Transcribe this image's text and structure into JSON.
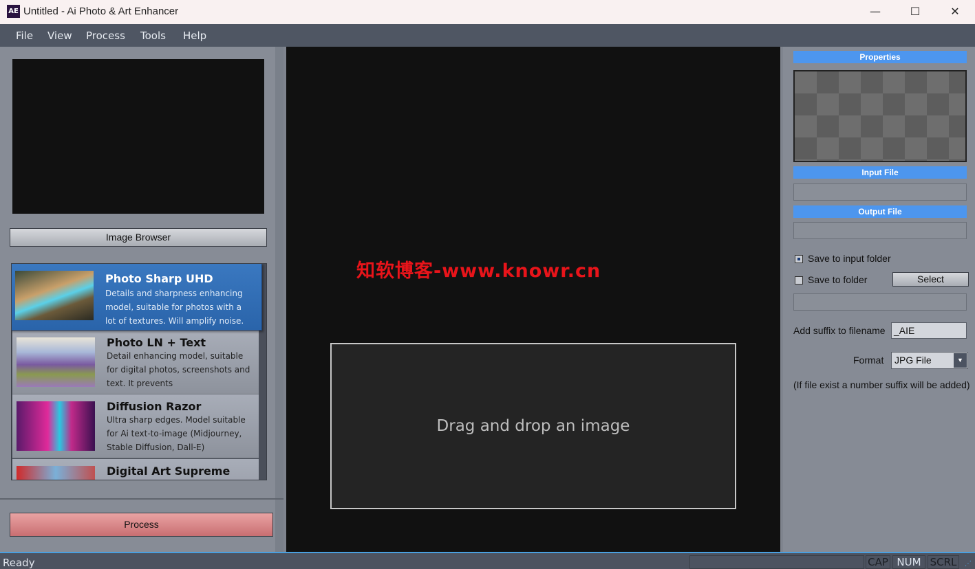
{
  "window": {
    "title": "Untitled - Ai Photo & Art Enhancer",
    "app_icon": "AE",
    "minimize": "—",
    "maximize": "☐",
    "close": "✕"
  },
  "menu": [
    "File",
    "View",
    "Process",
    "Tools",
    "Help"
  ],
  "left": {
    "image_browser": "Image Browser",
    "process": "Process",
    "models": [
      {
        "name": "Photo Sharp UHD",
        "desc": "Details and sharpness enhancing model, suitable for photos with a lot of textures. Will amplify noise.",
        "selected": true
      },
      {
        "name": "Photo LN + Text",
        "desc": "Detail enhancing model, suitable for digital photos, screenshots and text. It prevents"
      },
      {
        "name": "Diffusion Razor",
        "desc": "Ultra sharp edges. Model suitable for Ai text-to-image (Midjourney, Stable Diffusion, Dall-E)"
      },
      {
        "name": "Digital Art Supreme",
        "desc": ""
      }
    ]
  },
  "center": {
    "drop_text": "Drag and drop an image",
    "watermark": "知软博客-www.knowr.cn"
  },
  "right": {
    "properties": "Properties",
    "input_file": "Input File",
    "output_file": "Output File",
    "input_value": "",
    "output_value": "",
    "save_input": "Save to input folder",
    "save_input_checked": true,
    "save_folder": "Save to folder",
    "save_folder_checked": false,
    "select": "Select",
    "folder_value": "",
    "suffix_label": "Add suffix to filename",
    "suffix_value": "_AIE",
    "format_label": "Format",
    "format_value": "JPG File",
    "note": "(If file exist a number suffix will be added)"
  },
  "status": {
    "text": "Ready",
    "cap": "CAP",
    "num": "NUM",
    "scrl": "SCRL",
    "num_active": true
  },
  "colors": {
    "accent": "#4d96ee",
    "selected": "#2f6db4",
    "process_button": "#d98589",
    "watermark": "#e8141a"
  }
}
